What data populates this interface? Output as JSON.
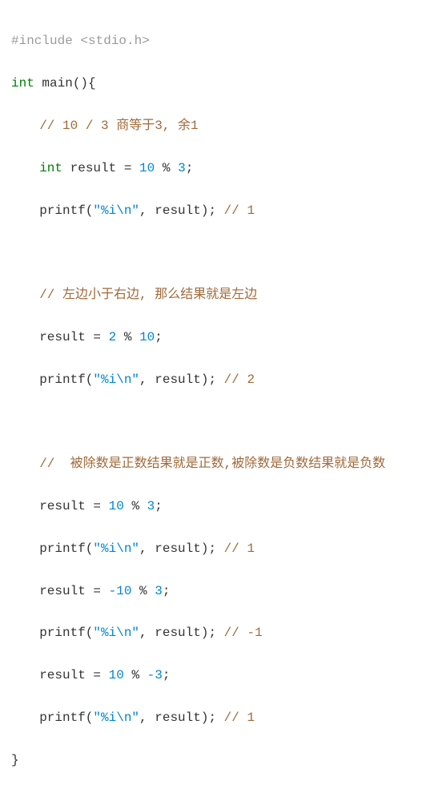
{
  "code": {
    "l1": {
      "preproc": "#include <stdio.h>"
    },
    "l2": {
      "kw_int": "int",
      "sp1": " ",
      "fn": "main",
      "paren": "()",
      "brace": "{"
    },
    "l3": {
      "comment": "// 10 / 3 商等于3, 余1"
    },
    "l4": {
      "kw_int": "int",
      "sp1": " ",
      "id": "result",
      "sp2": " ",
      "eq": "=",
      "sp3": " ",
      "n1": "10",
      "sp4": " ",
      "op": "%",
      "sp5": " ",
      "n2": "3",
      "semi": ";"
    },
    "l5": {
      "fn": "printf",
      "lp": "(",
      "q1": "\"",
      "fmt": "%i",
      "esc": "\\n",
      "q2": "\"",
      "comma": ", ",
      "id": "result",
      "rp": ")",
      "semi": ";",
      "sp": " ",
      "comment": "// 1"
    },
    "l7": {
      "comment": "// 左边小于右边, 那么结果就是左边"
    },
    "l8": {
      "id": "result",
      "sp1": " ",
      "eq": "=",
      "sp2": " ",
      "n1": "2",
      "sp3": " ",
      "op": "%",
      "sp4": " ",
      "n2": "10",
      "semi": ";"
    },
    "l9": {
      "fn": "printf",
      "lp": "(",
      "q1": "\"",
      "fmt": "%i",
      "esc": "\\n",
      "q2": "\"",
      "comma": ", ",
      "id": "result",
      "rp": ")",
      "semi": ";",
      "sp": " ",
      "comment": "// 2"
    },
    "l11": {
      "comment": "//  被除数是正数结果就是正数,被除数是负数结果就是负数"
    },
    "l12": {
      "id": "result",
      "sp1": " ",
      "eq": "=",
      "sp2": " ",
      "n1": "10",
      "sp3": " ",
      "op": "%",
      "sp4": " ",
      "n2": "3",
      "semi": ";"
    },
    "l13": {
      "fn": "printf",
      "lp": "(",
      "q1": "\"",
      "fmt": "%i",
      "esc": "\\n",
      "q2": "\"",
      "comma": ", ",
      "id": "result",
      "rp": ")",
      "semi": ";",
      "sp": " ",
      "comment": "// 1"
    },
    "l14": {
      "id": "result",
      "sp1": " ",
      "eq": "=",
      "sp2": " ",
      "n1": "-10",
      "sp3": " ",
      "op": "%",
      "sp4": " ",
      "n2": "3",
      "semi": ";"
    },
    "l15": {
      "fn": "printf",
      "lp": "(",
      "q1": "\"",
      "fmt": "%i",
      "esc": "\\n",
      "q2": "\"",
      "comma": ", ",
      "id": "result",
      "rp": ")",
      "semi": ";",
      "sp": " ",
      "comment": "// -1"
    },
    "l16": {
      "id": "result",
      "sp1": " ",
      "eq": "=",
      "sp2": " ",
      "n1": "10",
      "sp3": " ",
      "op": "%",
      "sp4": " ",
      "n2": "-3",
      "semi": ";"
    },
    "l17": {
      "fn": "printf",
      "lp": "(",
      "q1": "\"",
      "fmt": "%i",
      "esc": "\\n",
      "q2": "\"",
      "comma": ", ",
      "id": "result",
      "rp": ")",
      "semi": ";",
      "sp": " ",
      "comment": "// 1"
    },
    "l18": {
      "brace": "}"
    }
  }
}
